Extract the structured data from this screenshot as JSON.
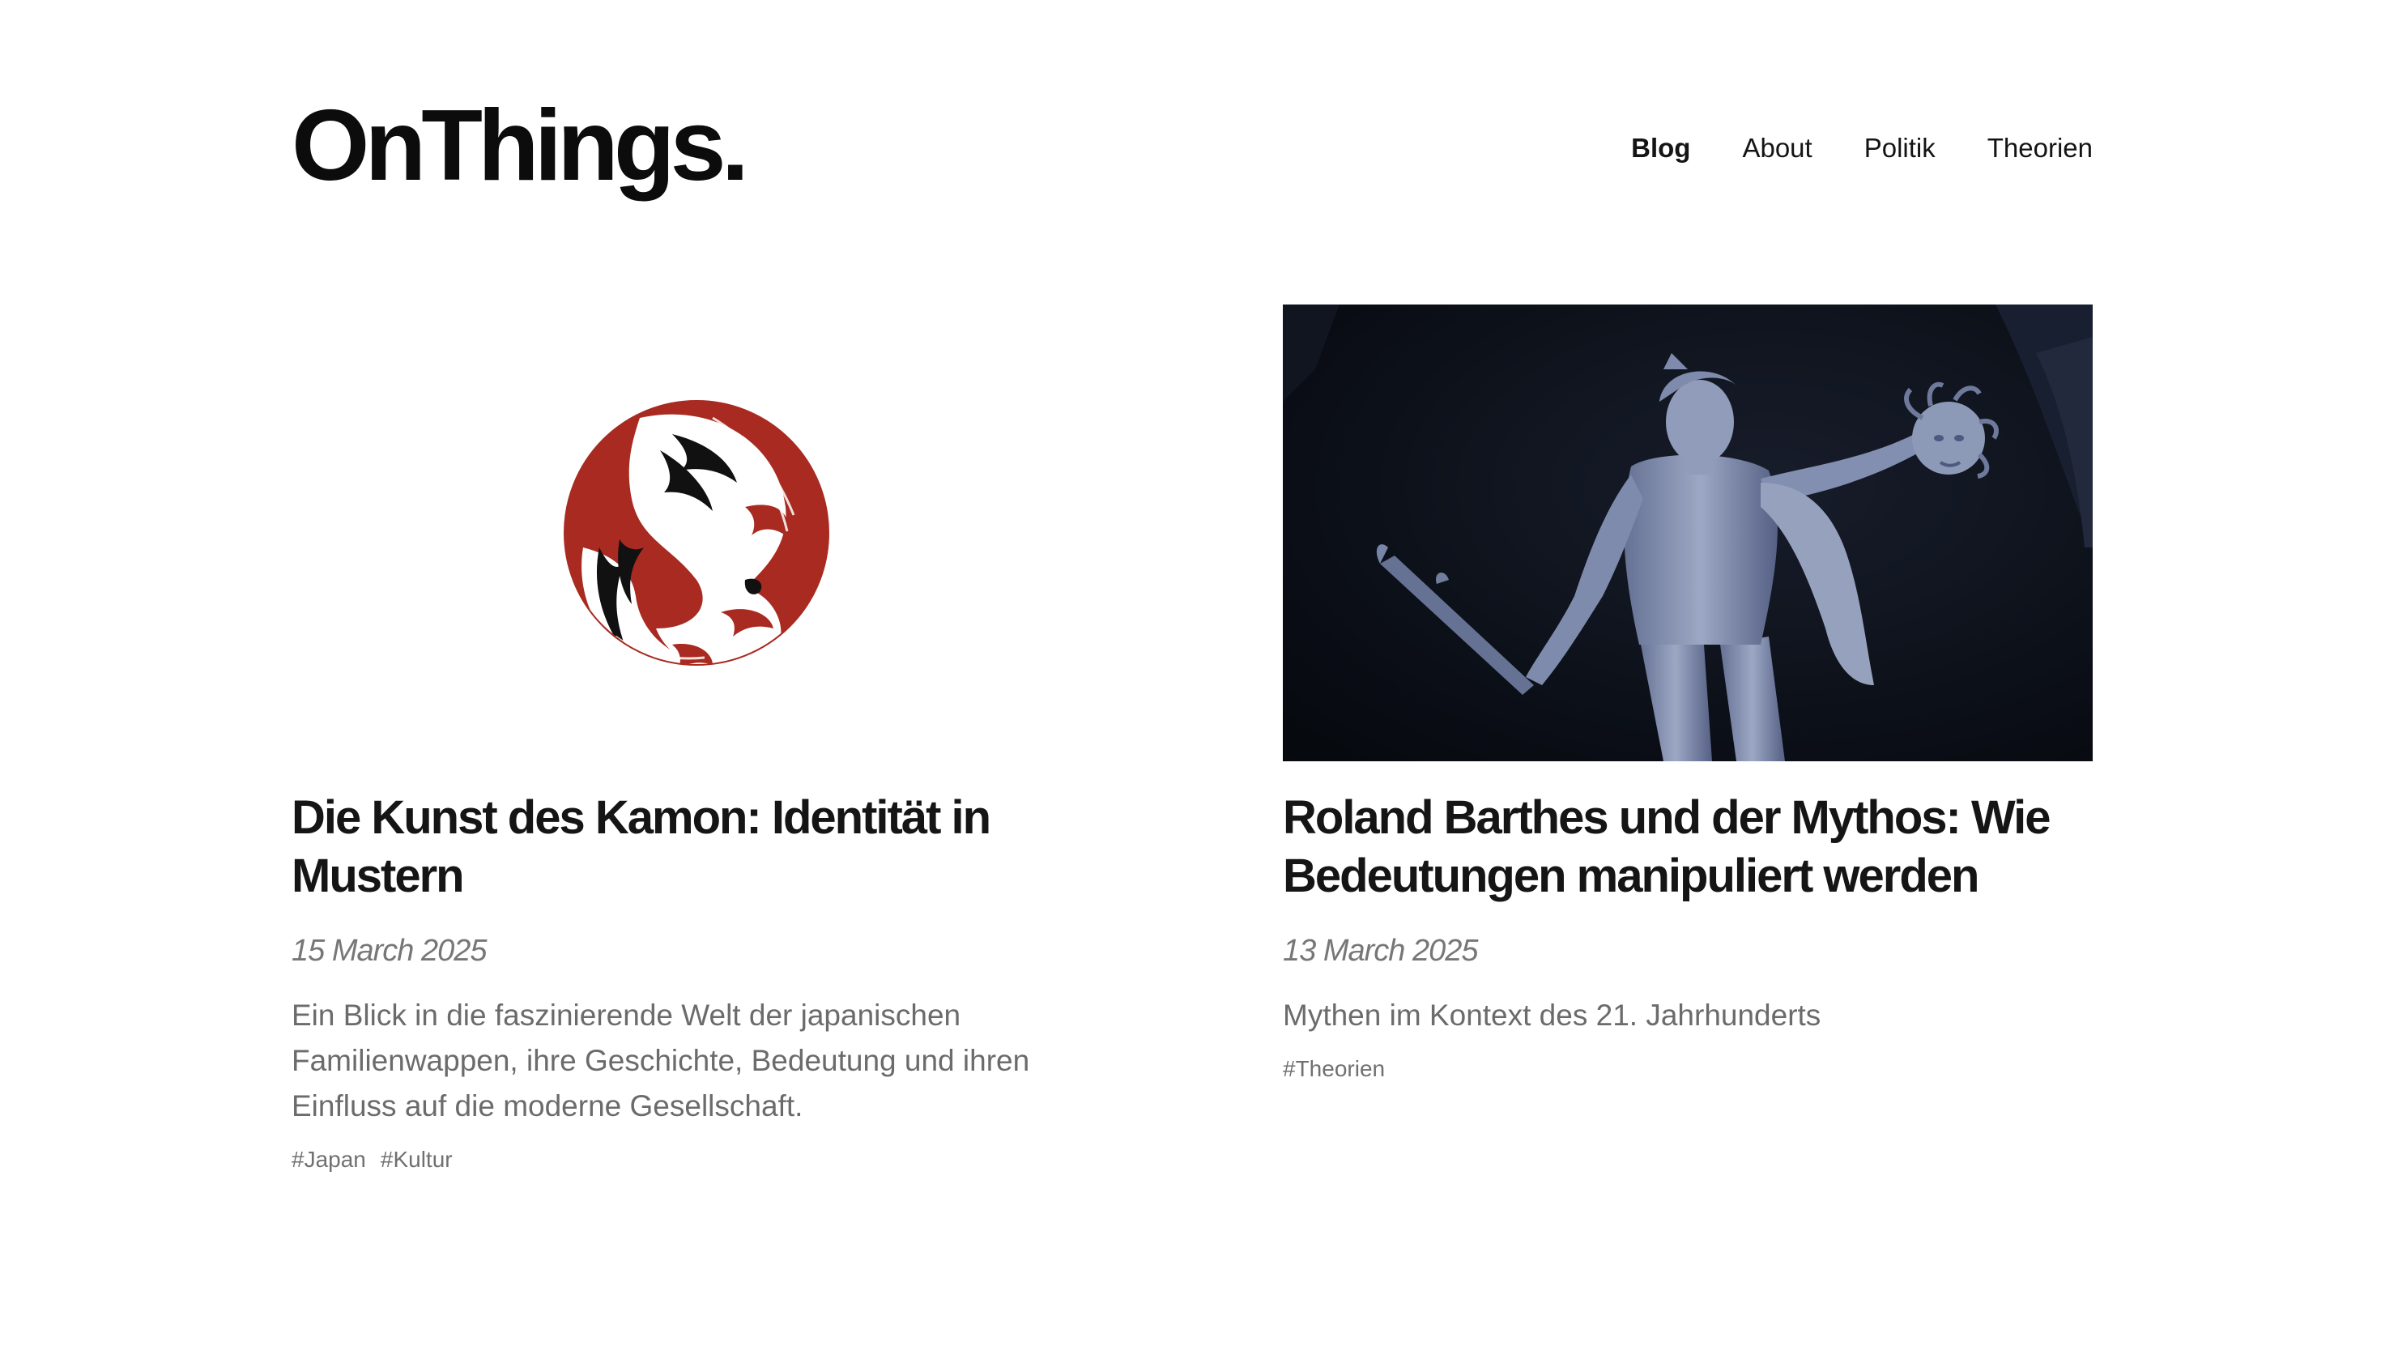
{
  "site": {
    "logo": "OnThings."
  },
  "nav": {
    "items": [
      {
        "label": "Blog",
        "active": true
      },
      {
        "label": "About",
        "active": false
      },
      {
        "label": "Politik",
        "active": false
      },
      {
        "label": "Theorien",
        "active": false
      }
    ]
  },
  "posts": [
    {
      "title": "Die Kunst des Kamon: Identität in Mustern",
      "date": "15 March 2025",
      "excerpt": "Ein Blick in die faszinierende Welt der japanischen Familienwappen, ihre Geschichte, Bedeutung und ihren Einfluss auf die moderne Gesellschaft.",
      "tags": [
        "#Japan",
        "#Kultur"
      ],
      "image": "kamon-wave-crest"
    },
    {
      "title": "Roland Barthes und der Mythos: Wie Bedeutungen manipuliert werden",
      "date": "13 March 2025",
      "excerpt": "Mythen im Kontext des 21. Jahrhunderts",
      "tags": [
        "#Theorien"
      ],
      "image": "perseus-statue-photo"
    }
  ],
  "colors": {
    "kamon_red": "#a82a20",
    "photo_dark": "#0d1018",
    "statue": "#9aa6c6"
  }
}
